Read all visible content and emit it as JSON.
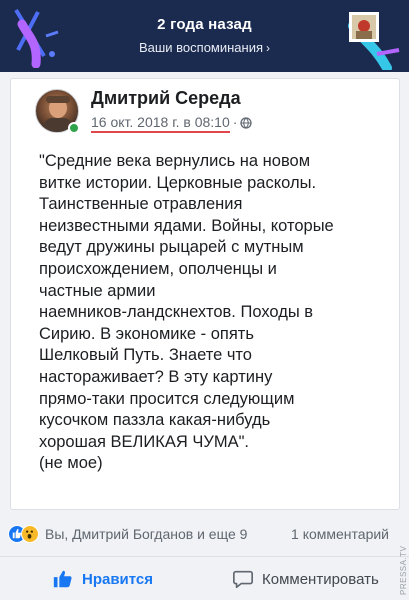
{
  "memories_banner": {
    "title": "2 года назад",
    "subtitle": "Ваши воспоминания",
    "chevron_icon": "chevron-right-icon",
    "accent_color": "#1b2a4f"
  },
  "post": {
    "author": "Дмитрий Середа",
    "date": "16 окт. 2018 г. в 08:10",
    "separator": "·",
    "privacy_icon": "globe-icon",
    "online_color": "#31a24c",
    "text": "\"Средние века вернулись на новом\nвитке истории. Церковные расколы.\nТаинственные отравления\nнеизвестными ядами. Войны, которые\nведут дружины рыцарей с мутным\nпроисхождением, ополченцы и\nчастные армии\nнаемников-ландскнехтов. Походы в\nСирию. В экономике - опять\nШелковый Путь. Знаете что\nнастораживает? В эту картину\nпрямо-таки просится следующим\nкусочком паззла  какая-нибудь\nхорошая ВЕЛИКАЯ ЧУМА\".\n(не мое)"
  },
  "reactions": {
    "icons": [
      "like-reaction-icon",
      "wow-reaction-icon"
    ],
    "names": "Вы, Дмитрий Богданов и еще 9",
    "comments": "1 комментарий"
  },
  "actions": {
    "like_label": "Нравится",
    "comment_label": "Комментировать",
    "like_color": "#1877f2"
  },
  "watermark": "PRESSA.TV"
}
